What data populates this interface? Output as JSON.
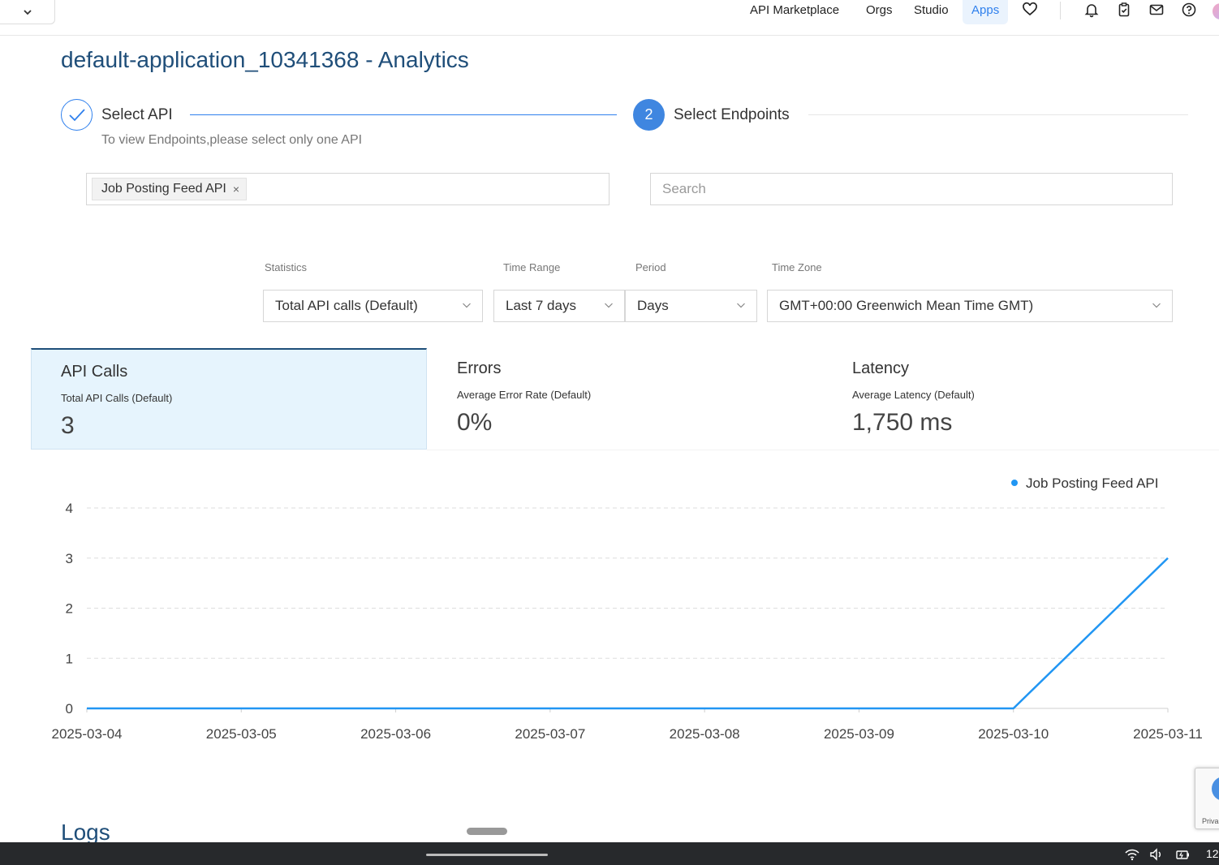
{
  "nav": {
    "links": [
      "API Marketplace",
      "Orgs",
      "Studio",
      "Apps"
    ],
    "active": "Apps"
  },
  "page": {
    "title": "default-application_10341368 - Analytics"
  },
  "stepper": {
    "step1_label": "Select API",
    "step2_number": "2",
    "step2_label": "Select Endpoints",
    "hint": "To view Endpoints,please select only one API"
  },
  "api_select": {
    "tag": "Job Posting Feed API",
    "tag_close": "×"
  },
  "search": {
    "placeholder": "Search",
    "value": ""
  },
  "filters": {
    "statistics": {
      "label": "Statistics",
      "value": "Total API calls (Default)"
    },
    "time_range": {
      "label": "Time Range",
      "value": "Last 7 days"
    },
    "period": {
      "label": "Period",
      "value": "Days"
    },
    "time_zone": {
      "label": "Time Zone",
      "value": "GMT+00:00 Greenwich Mean Time GMT)"
    }
  },
  "stats": {
    "calls": {
      "title": "API Calls",
      "sub": "Total API Calls (Default)",
      "value": "3"
    },
    "errors": {
      "title": "Errors",
      "sub": "Average Error Rate (Default)",
      "value": "0%"
    },
    "latency": {
      "title": "Latency",
      "sub": "Average Latency (Default)",
      "value": "1,750 ms"
    }
  },
  "chart_data": {
    "type": "line",
    "title": "",
    "xlabel": "",
    "ylabel": "",
    "x": [
      "2025-03-04",
      "2025-03-05",
      "2025-03-06",
      "2025-03-07",
      "2025-03-08",
      "2025-03-09",
      "2025-03-10",
      "2025-03-11"
    ],
    "series": [
      {
        "name": "Job Posting Feed API",
        "values": [
          0,
          0,
          0,
          0,
          0,
          0,
          0,
          3
        ],
        "color": "#2196f3"
      }
    ],
    "y_ticks": [
      0,
      1,
      2,
      3,
      4
    ],
    "ylim": [
      0,
      4
    ],
    "grid": true,
    "legend_position": "top-right"
  },
  "logs": {
    "heading": "Logs"
  },
  "recaptcha": {
    "text": "Priva"
  },
  "taskbar": {
    "clock": "12"
  },
  "colors": {
    "accent": "#2f80ed",
    "title": "#1f4e79",
    "card_active_bg": "#e6f4fd",
    "series": "#2196f3"
  }
}
